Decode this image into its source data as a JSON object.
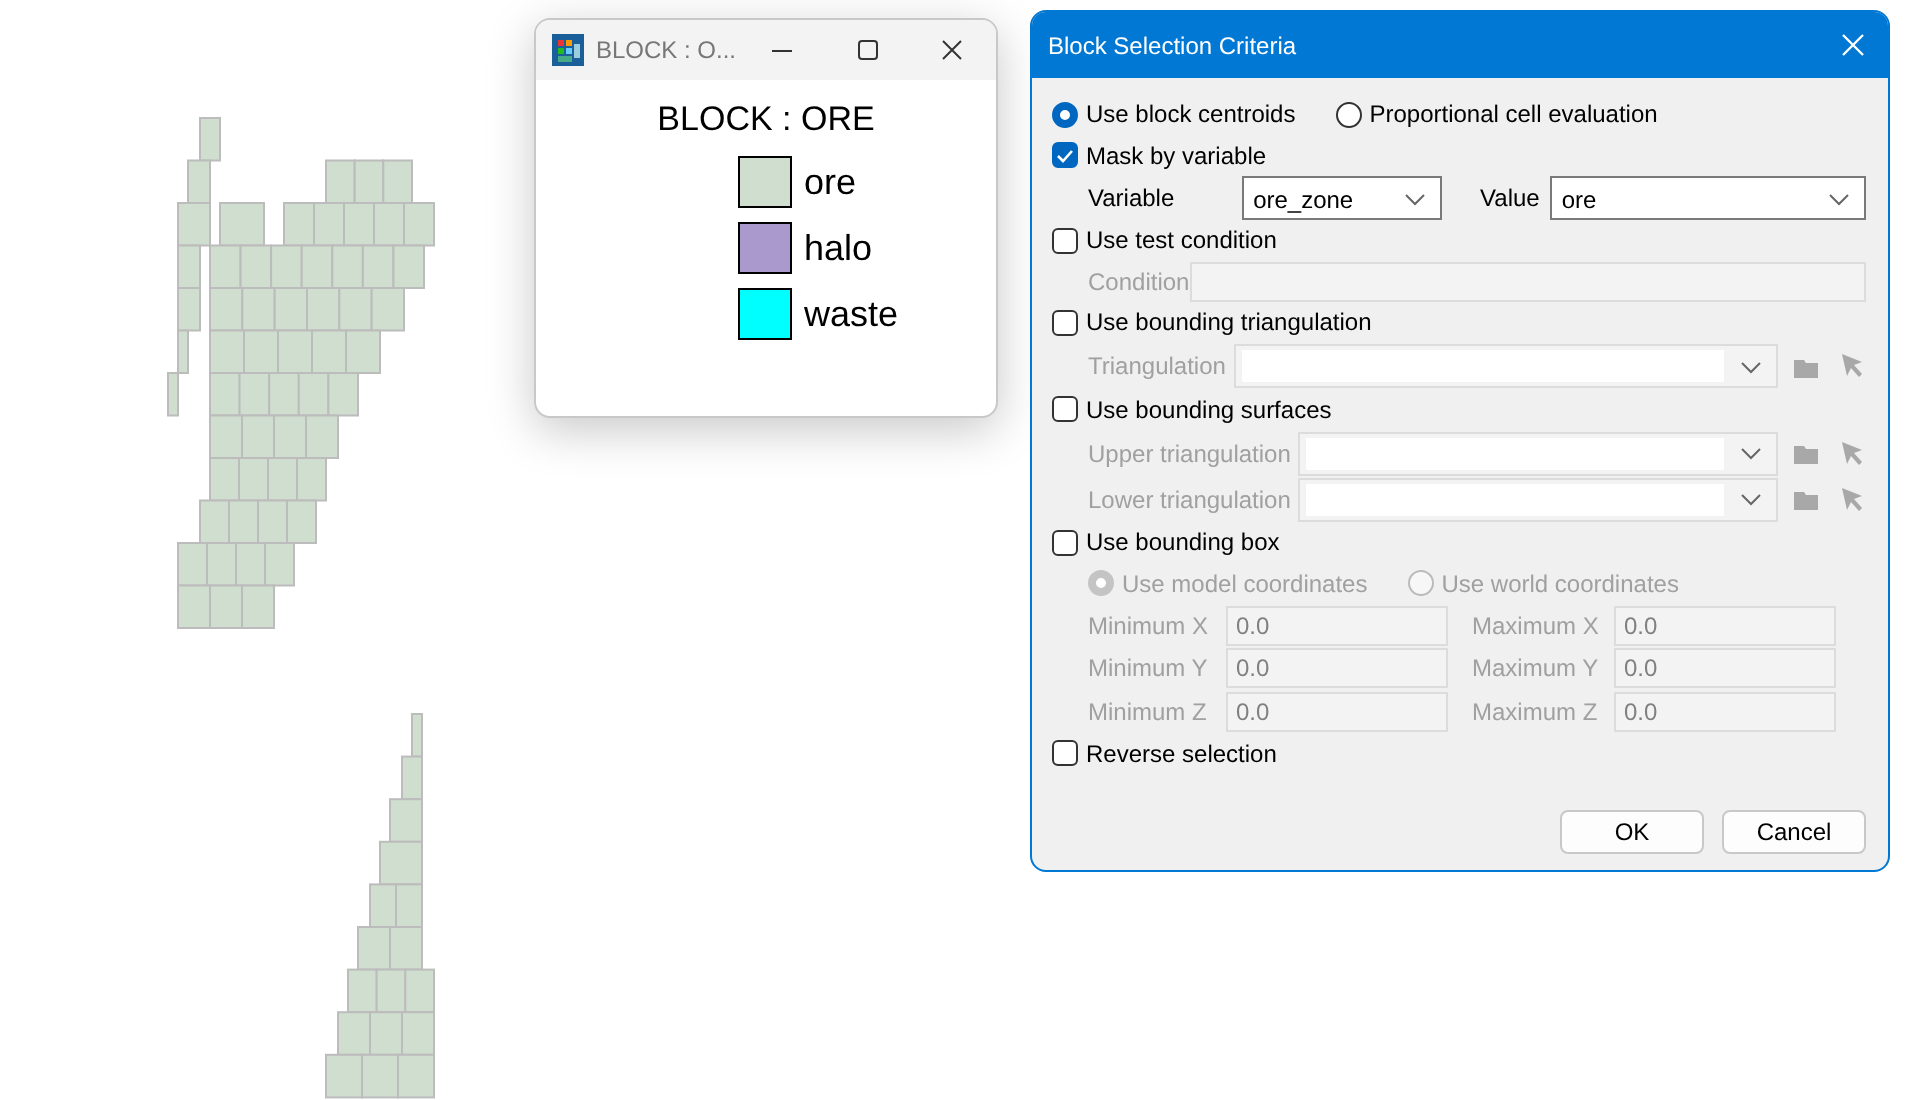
{
  "legend_window": {
    "title": "BLOCK : O...",
    "heading": "BLOCK : ORE",
    "entries": [
      {
        "label": "ore",
        "color": "#cfdecf"
      },
      {
        "label": "halo",
        "color": "#aa99cc"
      },
      {
        "label": "waste",
        "color": "#00ffff"
      }
    ]
  },
  "dialog": {
    "title": "Block Selection Criteria",
    "evaluation_options": [
      {
        "label": "Use block centroids",
        "selected": true
      },
      {
        "label": "Proportional cell evaluation",
        "selected": false
      }
    ],
    "sections": [
      {
        "kind": "mask",
        "label": "Mask by variable",
        "checked": true,
        "fields": [
          {
            "label": "Variable",
            "value": "ore_zone"
          },
          {
            "label": "Value",
            "value": "ore"
          }
        ]
      },
      {
        "kind": "condition",
        "label": "Use test condition",
        "checked": false,
        "fields": [
          {
            "label": "Condition"
          }
        ]
      },
      {
        "kind": "picker",
        "label": "Use bounding triangulation",
        "checked": false,
        "fields": [
          {
            "label": "Triangulation"
          }
        ]
      },
      {
        "kind": "picker",
        "label": "Use bounding surfaces",
        "checked": false,
        "fields": [
          {
            "label": "Upper triangulation"
          },
          {
            "label": "Lower triangulation"
          }
        ]
      },
      {
        "kind": "box",
        "label": "Use bounding box",
        "checked": false,
        "options": [
          {
            "label": "Use model coordinates",
            "selected": true
          },
          {
            "label": "Use world coordinates",
            "selected": false
          }
        ],
        "fields": [
          {
            "label": "Minimum X",
            "value": "0.0"
          },
          {
            "label": "Maximum X",
            "value": "0.0"
          },
          {
            "label": "Minimum Y",
            "value": "0.0"
          },
          {
            "label": "Maximum Y",
            "value": "0.0"
          },
          {
            "label": "Minimum Z",
            "value": "0.0"
          },
          {
            "label": "Maximum Z",
            "value": "0.0"
          }
        ]
      },
      {
        "kind": "plain",
        "label": "Reverse selection",
        "checked": false
      }
    ],
    "buttons": [
      "OK",
      "Cancel"
    ]
  }
}
